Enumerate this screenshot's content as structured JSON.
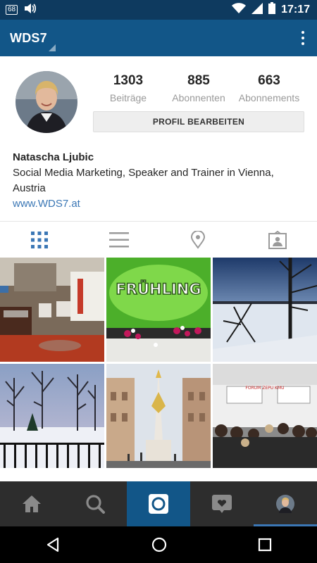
{
  "status_bar": {
    "notification_badge": "68",
    "time": "17:17",
    "icons": [
      "notification-badge-icon",
      "volume-icon",
      "wifi-icon",
      "signal-icon",
      "battery-icon"
    ]
  },
  "app_bar": {
    "title": "WDS7",
    "menu_icon": "overflow-menu-icon"
  },
  "profile": {
    "stats": [
      {
        "number": "1303",
        "label": "Beiträge"
      },
      {
        "number": "885",
        "label": "Abonnenten"
      },
      {
        "number": "663",
        "label": "Abonnements"
      }
    ],
    "edit_button": "PROFIL BEARBEITEN",
    "name": "Natascha Ljubic",
    "bio": "Social Media Marketing, Speaker and Trainer in Vienna, Austria",
    "website": "www.WDS7.at"
  },
  "view_tabs": [
    {
      "icon": "grid-view-icon",
      "active": true
    },
    {
      "icon": "list-view-icon",
      "active": false
    },
    {
      "icon": "map-pin-icon",
      "active": false
    },
    {
      "icon": "tagged-photos-icon",
      "active": false
    }
  ],
  "grid_photos": [
    {
      "icon": "photo-hotel-lobby"
    },
    {
      "icon": "photo-fruehling",
      "text": "FRÜHLING"
    },
    {
      "icon": "photo-winter-lake"
    },
    {
      "icon": "photo-snowy-park"
    },
    {
      "icon": "photo-vienna-column"
    },
    {
      "icon": "photo-conference",
      "text": "FORUM ZEPU KMU"
    }
  ],
  "bottom_nav": [
    {
      "icon": "home-icon",
      "active": false
    },
    {
      "icon": "search-icon",
      "active": false
    },
    {
      "icon": "camera-icon",
      "active": true
    },
    {
      "icon": "activity-heart-icon",
      "active": false
    },
    {
      "icon": "profile-avatar-icon",
      "active": false
    }
  ],
  "colors": {
    "status_bar": "#0e3a5f",
    "app_bar": "#125688",
    "bottom_nav": "#2d2d2d",
    "link": "#3b77b5",
    "accent": "#4a86c5"
  }
}
